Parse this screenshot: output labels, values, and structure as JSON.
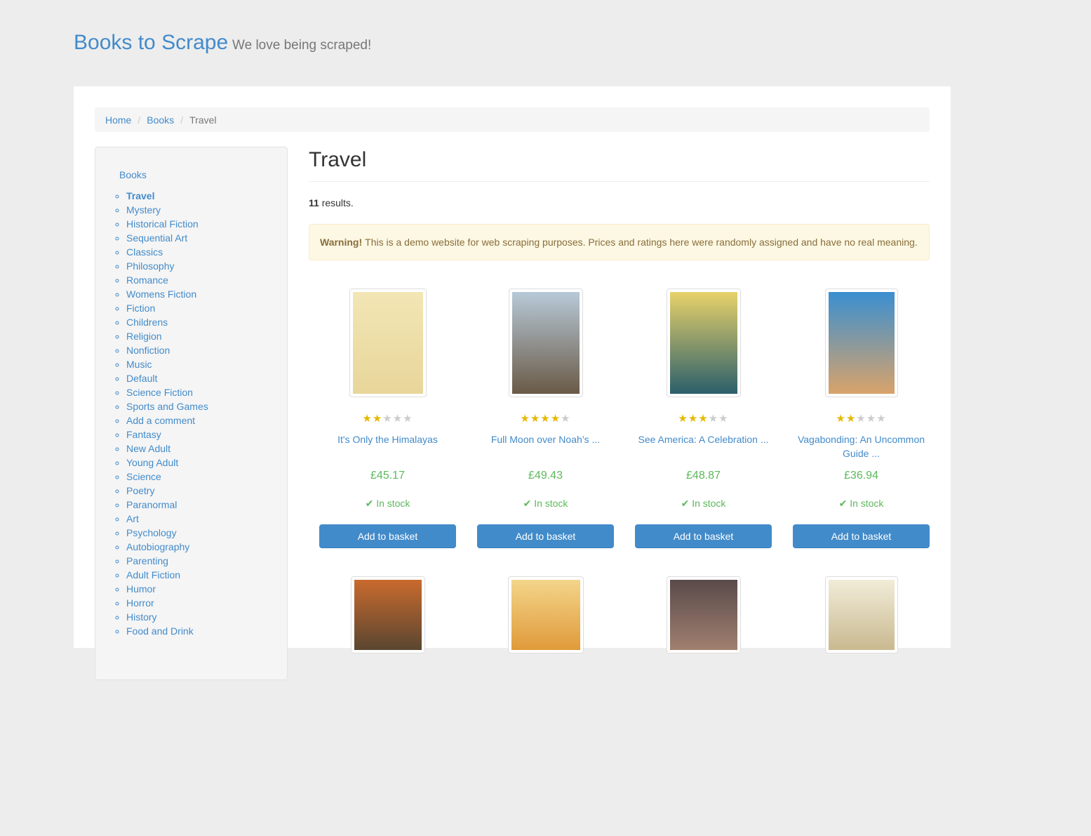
{
  "site": {
    "brand": "Books to Scrape",
    "tagline": "We love being scraped!"
  },
  "breadcrumb": [
    {
      "label": "Home"
    },
    {
      "label": "Books"
    },
    {
      "label": "Travel"
    }
  ],
  "sidebar": {
    "root": "Books",
    "categories": [
      "Travel",
      "Mystery",
      "Historical Fiction",
      "Sequential Art",
      "Classics",
      "Philosophy",
      "Romance",
      "Womens Fiction",
      "Fiction",
      "Childrens",
      "Religion",
      "Nonfiction",
      "Music",
      "Default",
      "Science Fiction",
      "Sports and Games",
      "Add a comment",
      "Fantasy",
      "New Adult",
      "Young Adult",
      "Science",
      "Poetry",
      "Paranormal",
      "Art",
      "Psychology",
      "Autobiography",
      "Parenting",
      "Adult Fiction",
      "Humor",
      "Horror",
      "History",
      "Food and Drink"
    ]
  },
  "main": {
    "heading": "Travel",
    "count_number": "11",
    "count_suffix": " results.",
    "warning_label": "Warning!",
    "warning_text": "This is a demo website for web scraping purposes. Prices and ratings here were randomly assigned and have no real meaning."
  },
  "products": [
    {
      "title": "It's Only the Himalayas",
      "rating": 2,
      "price": "£45.17",
      "stock": "In stock",
      "button": "Add to basket",
      "cover_colors": [
        "#f2e6b5",
        "#e8d69a"
      ]
    },
    {
      "title": "Full Moon over Noah’s ...",
      "rating": 4,
      "price": "£49.43",
      "stock": "In stock",
      "button": "Add to basket",
      "cover_colors": [
        "#b7c9d8",
        "#6a5a46"
      ]
    },
    {
      "title": "See America: A Celebration ...",
      "rating": 3,
      "price": "£48.87",
      "stock": "In stock",
      "button": "Add to basket",
      "cover_colors": [
        "#e8d26a",
        "#2b5f6b"
      ]
    },
    {
      "title": "Vagabonding: An Uncommon Guide ...",
      "rating": 2,
      "price": "£36.94",
      "stock": "In stock",
      "button": "Add to basket",
      "cover_colors": [
        "#3a8fd1",
        "#d9a36a"
      ]
    },
    {
      "title": "",
      "rating": 0,
      "price": "",
      "stock": "",
      "button": "",
      "cover_colors": [
        "#c96a2e",
        "#5a4630"
      ]
    },
    {
      "title": "",
      "rating": 0,
      "price": "",
      "stock": "",
      "button": "",
      "cover_colors": [
        "#f3d58a",
        "#e09a3a"
      ]
    },
    {
      "title": "",
      "rating": 0,
      "price": "",
      "stock": "",
      "button": "",
      "cover_colors": [
        "#5a4a4a",
        "#a08070"
      ]
    },
    {
      "title": "",
      "rating": 0,
      "price": "",
      "stock": "",
      "button": "",
      "cover_colors": [
        "#f1ecd8",
        "#c9b990"
      ]
    }
  ],
  "colors": {
    "link": "#428bca",
    "price": "#5cb85c",
    "button": "#428bca",
    "star_on": "#e6b800",
    "star_off": "#cccccc"
  }
}
